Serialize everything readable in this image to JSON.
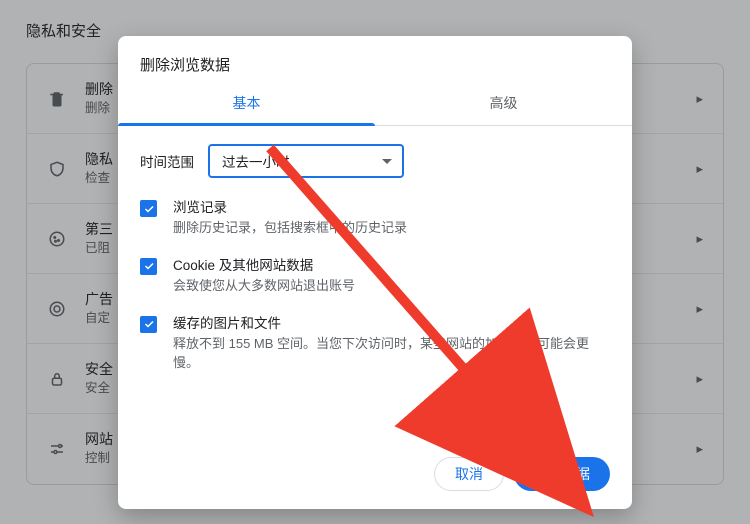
{
  "page": {
    "heading": "隐私和安全",
    "rows": [
      {
        "title": "删除",
        "sub": "删除"
      },
      {
        "title": "隐私",
        "sub": "检查"
      },
      {
        "title": "第三",
        "sub": "已阻"
      },
      {
        "title": "广告",
        "sub": "自定"
      },
      {
        "title": "安全",
        "sub": "安全"
      },
      {
        "title": "网站",
        "sub": "控制"
      }
    ]
  },
  "dialog": {
    "title": "删除浏览数据",
    "tabs": {
      "basic": "基本",
      "advanced": "高级"
    },
    "time_label": "时间范围",
    "time_value": "过去一小时",
    "options": [
      {
        "title": "浏览记录",
        "sub": "删除历史记录，包括搜索框中的历史记录"
      },
      {
        "title": "Cookie 及其他网站数据",
        "sub": "会致使您从大多数网站退出账号"
      },
      {
        "title": "缓存的图片和文件",
        "sub": "释放不到 155 MB 空间。当您下次访问时，某些网站的加载速度可能会更慢。"
      }
    ],
    "buttons": {
      "cancel": "取消",
      "confirm": "删除数据"
    }
  }
}
